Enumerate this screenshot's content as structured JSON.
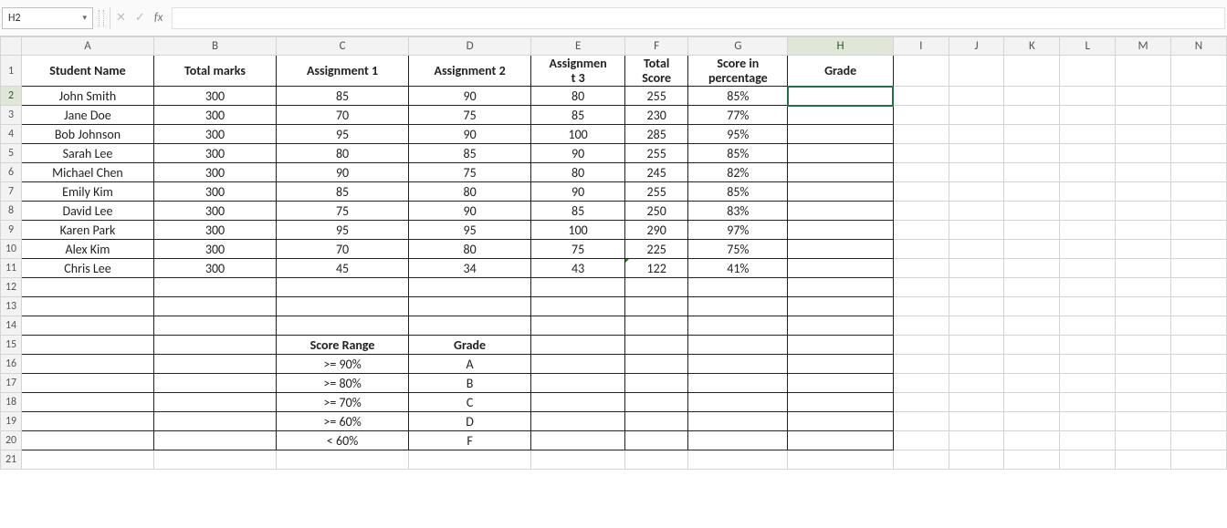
{
  "nameBox": "H2",
  "formulaValue": "",
  "columns": [
    "A",
    "B",
    "C",
    "D",
    "E",
    "F",
    "G",
    "H",
    "I",
    "J",
    "K",
    "L",
    "M",
    "N"
  ],
  "selection": {
    "col": "H",
    "row": 2
  },
  "headers": {
    "A": "Student Name",
    "B": "Total marks",
    "C": "Assignment 1",
    "D": "Assignment 2",
    "E": "Assignment 3",
    "F": "Total Score",
    "G": "Score in percentage",
    "H": "Grade"
  },
  "students": [
    {
      "name": "John Smith",
      "total": 300,
      "a1": 85,
      "a2": 90,
      "a3": 80,
      "score": 255,
      "pct": "85%",
      "grade": ""
    },
    {
      "name": "Jane Doe",
      "total": 300,
      "a1": 70,
      "a2": 75,
      "a3": 85,
      "score": 230,
      "pct": "77%",
      "grade": ""
    },
    {
      "name": "Bob Johnson",
      "total": 300,
      "a1": 95,
      "a2": 90,
      "a3": 100,
      "score": 285,
      "pct": "95%",
      "grade": ""
    },
    {
      "name": "Sarah Lee",
      "total": 300,
      "a1": 80,
      "a2": 85,
      "a3": 90,
      "score": 255,
      "pct": "85%",
      "grade": ""
    },
    {
      "name": "Michael Chen",
      "total": 300,
      "a1": 90,
      "a2": 75,
      "a3": 80,
      "score": 245,
      "pct": "82%",
      "grade": ""
    },
    {
      "name": "Emily Kim",
      "total": 300,
      "a1": 85,
      "a2": 80,
      "a3": 90,
      "score": 255,
      "pct": "85%",
      "grade": ""
    },
    {
      "name": "David Lee",
      "total": 300,
      "a1": 75,
      "a2": 90,
      "a3": 85,
      "score": 250,
      "pct": "83%",
      "grade": ""
    },
    {
      "name": "Karen Park",
      "total": 300,
      "a1": 95,
      "a2": 95,
      "a3": 100,
      "score": 290,
      "pct": "97%",
      "grade": ""
    },
    {
      "name": "Alex Kim",
      "total": 300,
      "a1": 70,
      "a2": 80,
      "a3": 75,
      "score": 225,
      "pct": "75%",
      "grade": ""
    },
    {
      "name": "Chris Lee",
      "total": 300,
      "a1": 45,
      "a2": 34,
      "a3": 43,
      "score": 122,
      "pct": "41%",
      "grade": ""
    }
  ],
  "gradeTable": {
    "header": {
      "range": "Score Range",
      "grade": "Grade"
    },
    "rows": [
      {
        "range": ">= 90%",
        "grade": "A"
      },
      {
        "range": ">= 80%",
        "grade": "B"
      },
      {
        "range": ">= 70%",
        "grade": "C"
      },
      {
        "range": ">= 60%",
        "grade": "D"
      },
      {
        "range": "< 60%",
        "grade": "F"
      }
    ]
  },
  "icons": {
    "cancel": "✕",
    "enter": "✓",
    "fx": "fx"
  }
}
